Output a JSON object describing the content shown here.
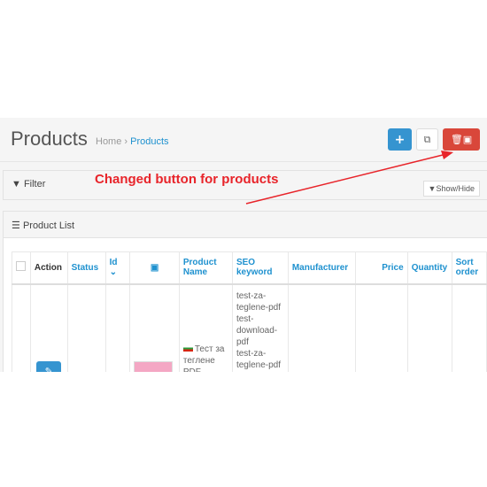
{
  "header": {
    "title": "Products",
    "breadcrumb": [
      {
        "label": "Home"
      },
      {
        "label": "Products"
      }
    ],
    "buttons": {
      "add": "+",
      "copy": "copy-icon",
      "delete": "delete-with-images-icon"
    }
  },
  "filter": {
    "label": "Filter",
    "show_hide": "Show/Hide"
  },
  "product_list": {
    "label": "Product List",
    "columns": [
      "Action",
      "Status",
      "Id",
      "Product Name",
      "SEO keyword",
      "Manufacturer",
      "Price",
      "Quantity",
      "Sort order"
    ],
    "rows": [
      {
        "name": "Тест за теглене PDF",
        "seo": [
          "test-za-",
          "teglene-pdf",
          "test-",
          "download-",
          "pdf",
          "test-za-",
          "teglene-pdf"
        ]
      }
    ]
  },
  "annotation": "Changed button for products",
  "colors": {
    "accent": "#1e91cf",
    "primary": "#3594d0",
    "danger": "#d9473a",
    "annotation": "#e8242a"
  }
}
